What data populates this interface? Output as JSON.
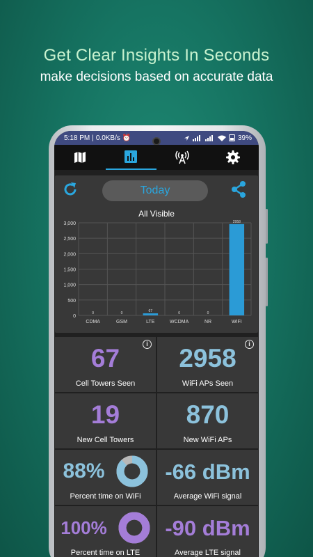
{
  "promo": {
    "title": "Get Clear Insights In Seconds",
    "subtitle": "make decisions based on  accurate data"
  },
  "status_bar": {
    "time": "5:18 PM",
    "speed": "0.0KB/s",
    "battery": "39%",
    "color": "#3f4a80"
  },
  "tabs": [
    {
      "icon": "map-icon",
      "active": false
    },
    {
      "icon": "bar-chart-icon",
      "active": true
    },
    {
      "icon": "antenna-icon",
      "active": false
    },
    {
      "icon": "gear-icon",
      "active": false
    }
  ],
  "controls": {
    "period_label": "Today",
    "accent": "#2aa6de"
  },
  "chart_data": {
    "type": "bar",
    "title": "All Visible",
    "categories": [
      "CDMA",
      "GSM",
      "LTE",
      "WCDMA",
      "NR",
      "WIFI"
    ],
    "values": [
      0,
      0,
      67,
      0,
      0,
      2958
    ],
    "value_labels": [
      "0",
      "0",
      "67",
      "0",
      "0",
      "2958"
    ],
    "ylim": [
      0,
      3000
    ],
    "yticks": [
      0,
      500,
      1000,
      1500,
      2000,
      2500,
      3000
    ],
    "ytick_labels": [
      "0",
      "500",
      "1,000",
      "1,500",
      "2,000",
      "2,500",
      "3,000"
    ],
    "grid": true,
    "bar_color": "#2b9bd6"
  },
  "stats": {
    "cell_towers_seen": {
      "value": "67",
      "label": "Cell Towers Seen"
    },
    "wifi_aps_seen": {
      "value": "2958",
      "label": "WiFi APs Seen"
    },
    "new_cell_towers": {
      "value": "19",
      "label": "New Cell Towers"
    },
    "new_wifi_aps": {
      "value": "870",
      "label": "New WiFi APs"
    },
    "percent_wifi": {
      "value": "88%",
      "label": "Percent time on WiFi",
      "fraction": 0.88
    },
    "avg_wifi_signal": {
      "value": "-66 dBm",
      "label": "Average WiFi signal"
    },
    "percent_lte": {
      "value": "100%",
      "label": "Percent time on LTE",
      "fraction": 1.0
    },
    "avg_lte_signal": {
      "value": "-90 dBm",
      "label": "Average LTE signal"
    }
  },
  "colors": {
    "purple": "#a47dd8",
    "blue": "#8cc2dc"
  }
}
